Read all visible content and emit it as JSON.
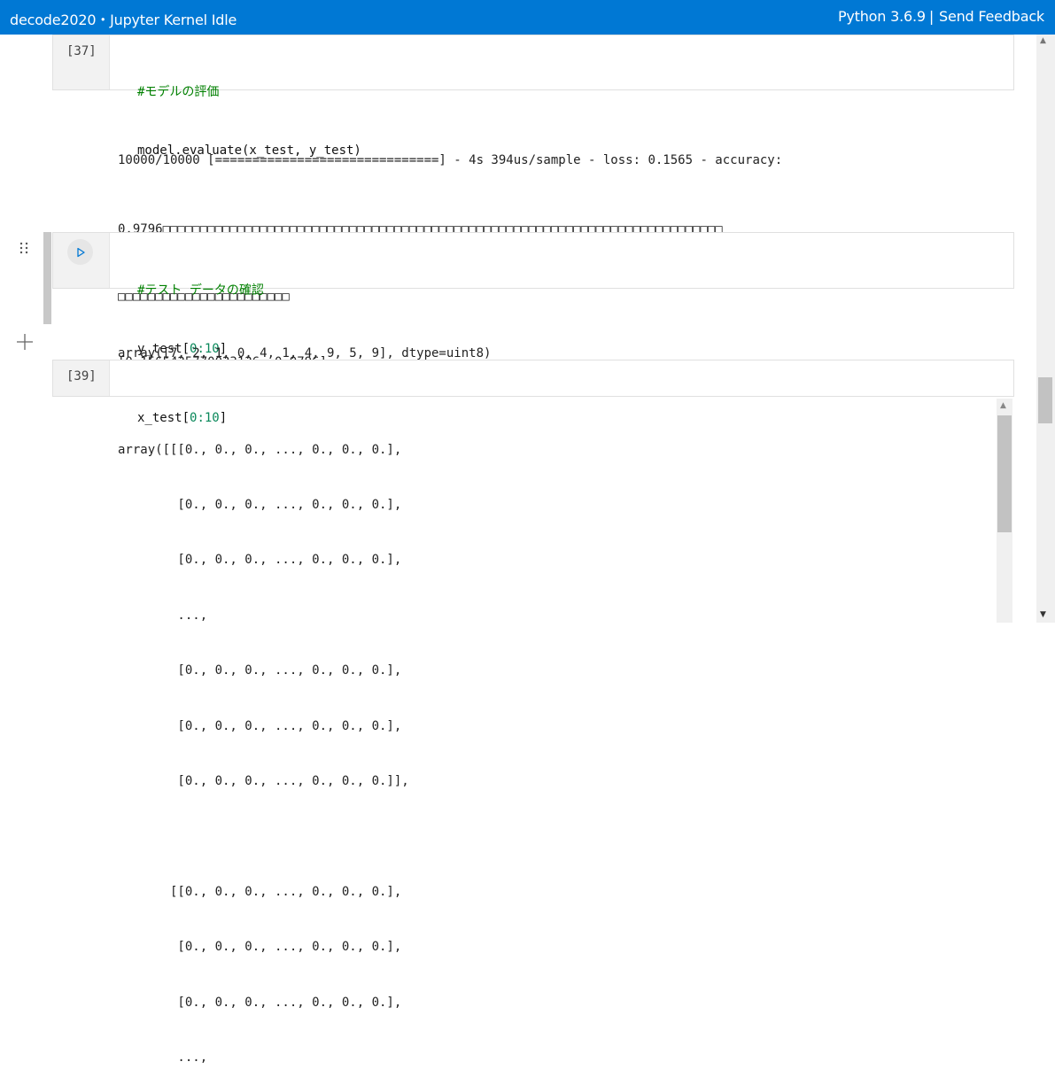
{
  "header": {
    "title": "decode2020・Jupyter Kernel Idle",
    "kernel": "Python 3.6.9",
    "separator": "|",
    "feedback": "Send Feedback"
  },
  "cells": [
    {
      "count": "[37]",
      "code": [
        "#モデルの評価",
        "model.evaluate(x_test, y_test)"
      ],
      "output": [
        "10000/10000 [==============================] - 4s 394us/sample - loss: 0.1565 - accuracy:",
        "0.9796□□□□□□□□□□□□□□□□□□□□□□□□□□□□□□□□□□□□□□□□□□□□□□□□□□□□□□□□□□□□□□□□□□□□□□□□□□□",
        "□□□□□□□□□□□□□□□□□□□□□□□",
        "[0.1565425770023126, 0.9796]"
      ]
    },
    {
      "count": "",
      "code_comment": "#テスト データの確認",
      "code_prefix": "y_test[",
      "code_nums": "0:10",
      "code_suffix": "]",
      "output": "array([7, 2, 1, 0, 4, 1, 4, 9, 5, 9], dtype=uint8)"
    },
    {
      "count": "[39]",
      "code_prefix": "x_test[",
      "code_nums": "0:10",
      "code_suffix": "]",
      "output": [
        "array([[[0., 0., 0., ..., 0., 0., 0.],",
        "        [0., 0., 0., ..., 0., 0., 0.],",
        "        [0., 0., 0., ..., 0., 0., 0.],",
        "        ...,",
        "        [0., 0., 0., ..., 0., 0., 0.],",
        "        [0., 0., 0., ..., 0., 0., 0.],",
        "        [0., 0., 0., ..., 0., 0., 0.]],",
        "",
        "       [[0., 0., 0., ..., 0., 0., 0.],",
        "        [0., 0., 0., ..., 0., 0., 0.],",
        "        [0., 0., 0., ..., 0., 0., 0.],",
        "        ...,"
      ]
    }
  ],
  "icons": {
    "run": "run-icon",
    "drag": "drag-handle-icon",
    "add": "add-cell-icon"
  },
  "colors": {
    "header_bg": "#0078d4",
    "comment": "#008000",
    "number": "#09885a"
  }
}
